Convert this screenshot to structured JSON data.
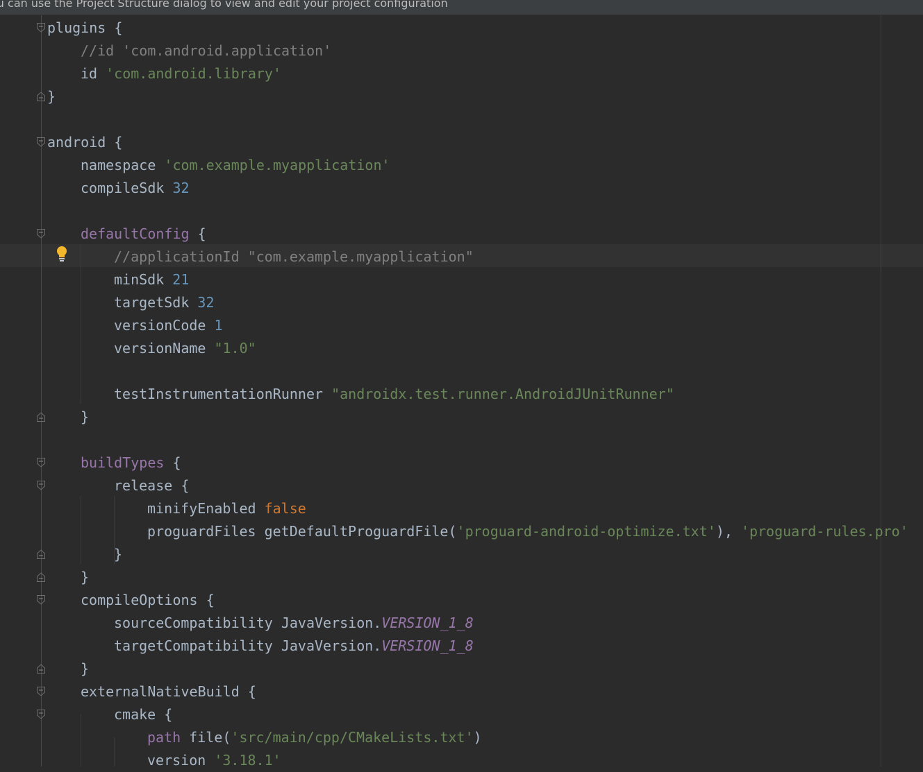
{
  "banner": {
    "text": "ou can use the Project Structure dialog to view and edit your project configuration"
  },
  "code": {
    "l01_a": "plugins {",
    "l02_comment": "//id 'com.android.application'",
    "l03_id": "id ",
    "l03_str": "'com.android.library'",
    "l04": "}",
    "l06_a": "android {",
    "l07_a": "namespace ",
    "l07_str": "'com.example.myapplication'",
    "l08_a": "compileSdk ",
    "l08_num": "32",
    "l10_kw": "defaultConfig",
    "l10_b": " {",
    "l11_comment": "//applicationId \"com.example.myapplication\"",
    "l12_a": "minSdk ",
    "l12_num": "21",
    "l13_a": "targetSdk ",
    "l13_num": "32",
    "l14_a": "versionCode ",
    "l14_num": "1",
    "l15_a": "versionName ",
    "l15_str": "\"1.0\"",
    "l17_a": "testInstrumentationRunner ",
    "l17_str": "\"androidx.test.runner.AndroidJUnitRunner\"",
    "l18": "}",
    "l20_kw": "buildTypes",
    "l20_b": " {",
    "l21_a": "release {",
    "l22_a": "minifyEnabled ",
    "l22_kw": "false",
    "l23_a": "proguardFiles getDefaultProguardFile(",
    "l23_str1": "'proguard-android-optimize.txt'",
    "l23_b": "), ",
    "l23_str2": "'proguard-rules.pro'",
    "l24": "}",
    "l25": "}",
    "l26_a": "compileOptions {",
    "l27_a": "sourceCompatibility JavaVersion.",
    "l27_const": "VERSION_1_8",
    "l28_a": "targetCompatibility JavaVersion.",
    "l28_const": "VERSION_1_8",
    "l29": "}",
    "l30_a": "externalNativeBuild {",
    "l31_a": "cmake {",
    "l32_kw": "path",
    "l32_a": " file(",
    "l32_str": "'src/main/cpp/CMakeLists.txt'",
    "l32_b": ")",
    "l33_a": "version ",
    "l33_str": "'3.18.1'"
  },
  "colors": {
    "background": "#2b2b2b",
    "default_text": "#a9b7c6",
    "comment": "#808080",
    "string": "#6a8759",
    "number": "#6897bb",
    "keyword": "#cc7832",
    "dsl_method": "#9876aa",
    "bulb": "#f3b52b"
  },
  "icons": {
    "fold_start": "fold-start-icon",
    "fold_end": "fold-end-icon",
    "intention": "lightbulb-icon"
  }
}
